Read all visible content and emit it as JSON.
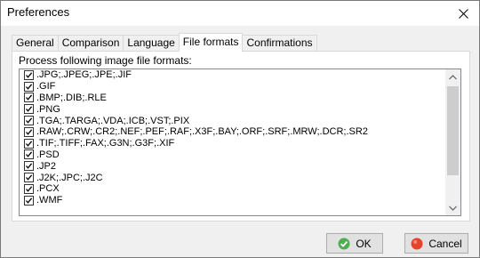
{
  "window": {
    "title": "Preferences"
  },
  "tabs": [
    {
      "label": "General",
      "active": false
    },
    {
      "label": "Comparison",
      "active": false
    },
    {
      "label": "Language",
      "active": false
    },
    {
      "label": "File formats",
      "active": true
    },
    {
      "label": "Confirmations",
      "active": false
    }
  ],
  "panel": {
    "group_label": "Process following image file formats:",
    "formats": [
      {
        "label": ".JPG;.JPEG;.JPE;.JIF",
        "checked": true
      },
      {
        "label": ".GIF",
        "checked": true
      },
      {
        "label": ".BMP;.DIB;.RLE",
        "checked": true
      },
      {
        "label": ".PNG",
        "checked": true
      },
      {
        "label": ".TGA;.TARGA;.VDA;.ICB;.VST;.PIX",
        "checked": true
      },
      {
        "label": ".RAW;.CRW;.CR2;.NEF;.PEF;.RAF;.X3F;.BAY;.ORF;.SRF;.MRW;.DCR;.SR2",
        "checked": true
      },
      {
        "label": ".TIF;.TIFF;.FAX;.G3N;.G3F;.XIF",
        "checked": true
      },
      {
        "label": ".PSD",
        "checked": true
      },
      {
        "label": ".JP2",
        "checked": true
      },
      {
        "label": ".J2K;.JPC;.J2C",
        "checked": true
      },
      {
        "label": ".PCX",
        "checked": true
      },
      {
        "label": ".WMF",
        "checked": true
      }
    ]
  },
  "buttons": {
    "ok": "OK",
    "cancel": "Cancel"
  },
  "icons": {
    "close": "close-icon",
    "checkbox": "checkmark-icon",
    "ok": "ok-icon",
    "cancel": "cancel-icon",
    "scroll_up": "chevron-up-icon",
    "scroll_down": "chevron-down-icon"
  },
  "colors": {
    "ok_icon": "#4caf50",
    "cancel_icon": "#e8412c"
  }
}
